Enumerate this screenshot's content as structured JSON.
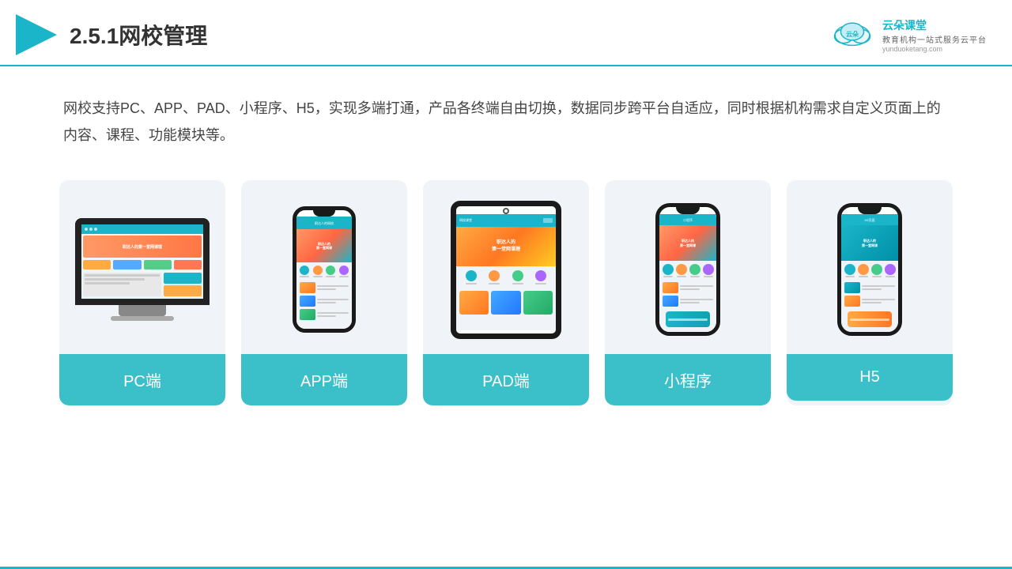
{
  "header": {
    "title": "2.5.1网校管理",
    "logo_main": "云朵课堂",
    "logo_url": "yunduoketang.com",
    "logo_tagline_1": "教育机构一站",
    "logo_tagline_2": "式服务云平台"
  },
  "description": {
    "text": "网校支持PC、APP、PAD、小程序、H5，实现多端打通，产品各终端自由切换，数据同步跨平台自适应，同时根据机构需求自定义页面上的内容、课程、功能模块等。"
  },
  "cards": [
    {
      "label": "PC端",
      "type": "pc"
    },
    {
      "label": "APP端",
      "type": "phone"
    },
    {
      "label": "PAD端",
      "type": "tablet"
    },
    {
      "label": "小程序",
      "type": "phone_mini"
    },
    {
      "label": "H5",
      "type": "phone_mini2"
    }
  ]
}
